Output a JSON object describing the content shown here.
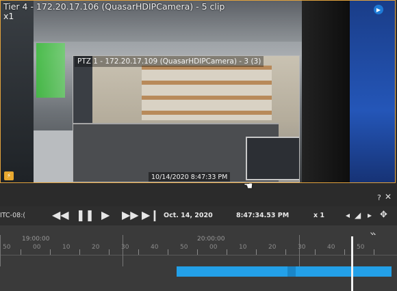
{
  "tile": {
    "title": "Tier 4 - 172.20.17.106 (QuasarHDIPCamera) - 5 clip",
    "speed": "x1"
  },
  "ptz": {
    "title": "PTZ 1 - 172.20.17.109 (QuasarHDIPCamera) - 3 (3)",
    "timestamp": "10/14/2020 8:47:33 PM"
  },
  "help": {
    "question": "?",
    "close": "✕"
  },
  "controls": {
    "camera_label": "ITC-08:(",
    "date": "Oct. 14, 2020",
    "time": "8:47:34.53 PM",
    "speed": "x 1"
  },
  "timeline": {
    "hour_labels": [
      "19:00:00",
      "20:00:00"
    ],
    "minute_labels": [
      "50",
      "00",
      "10",
      "20",
      "30",
      "40",
      "50",
      "00",
      "10",
      "20",
      "30",
      "40",
      "50"
    ]
  },
  "colors": {
    "accent": "#e2a23c",
    "recording": "#23a0e8",
    "badge": "#1e7ad6"
  }
}
